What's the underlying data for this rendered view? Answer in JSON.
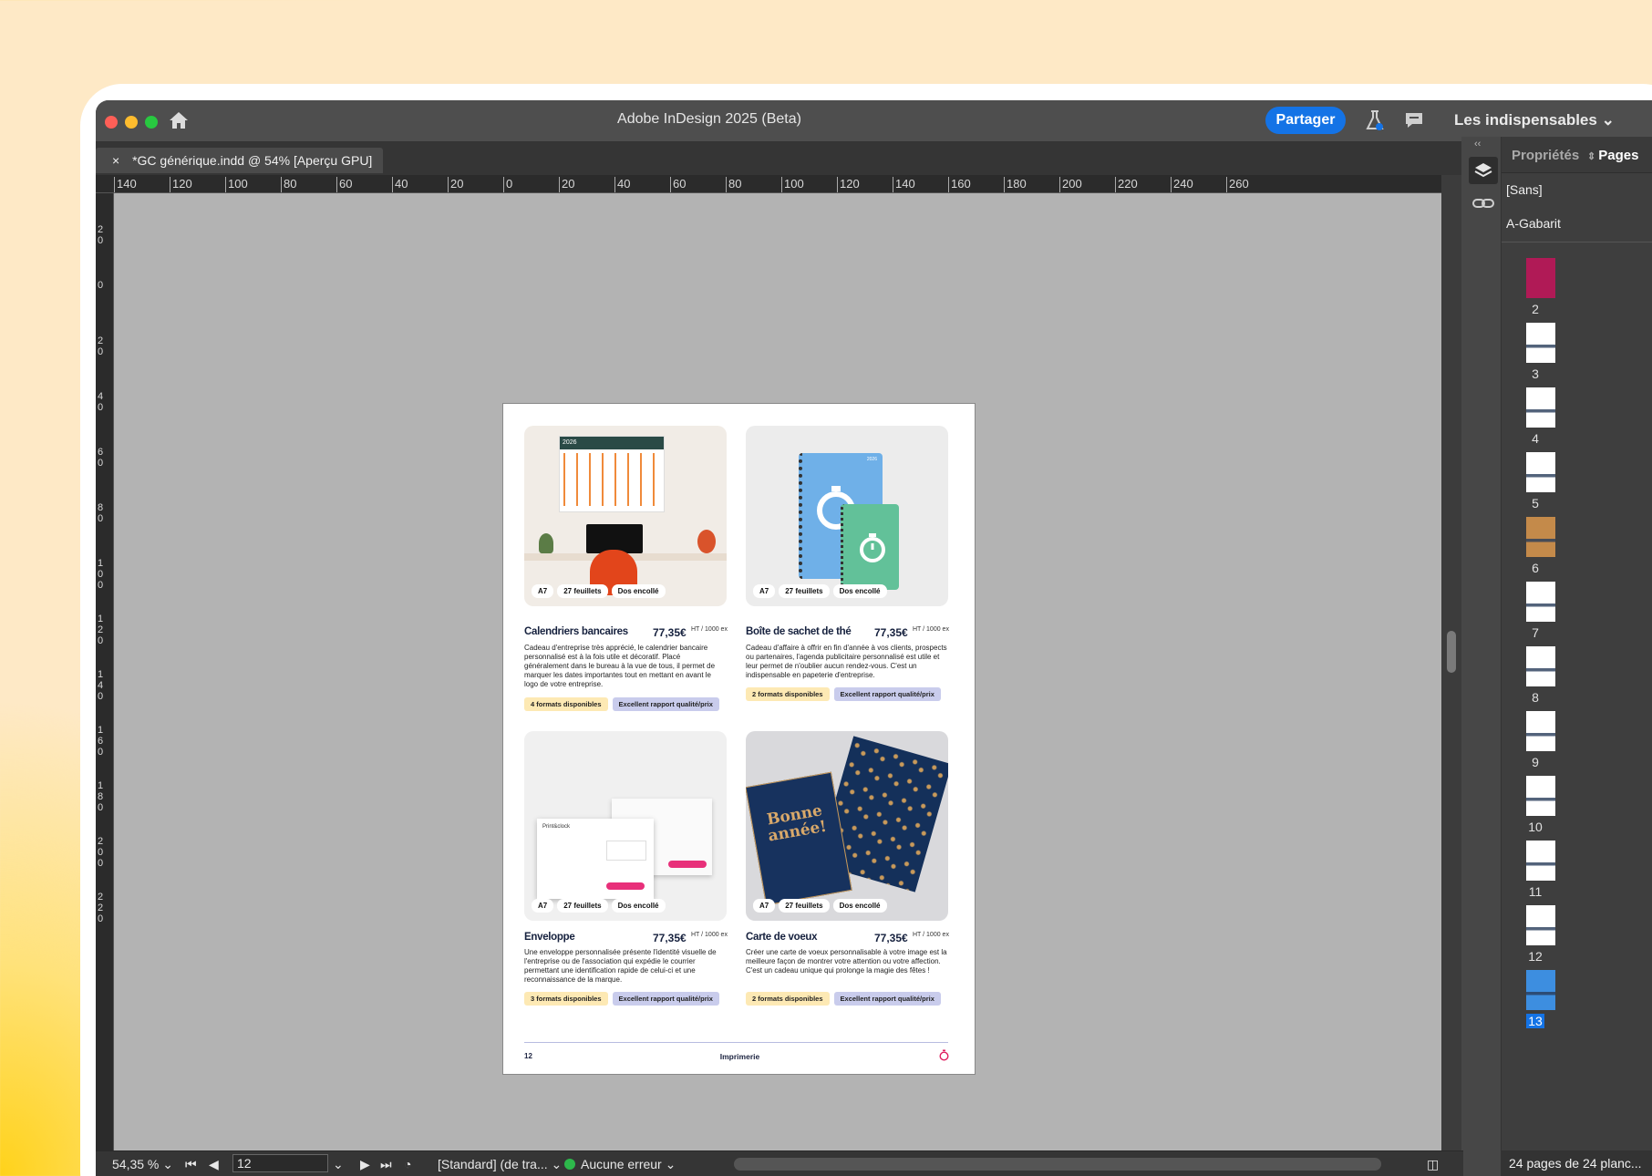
{
  "window": {
    "title": "Adobe InDesign 2025 (Beta)",
    "share_label": "Partager",
    "workspace": "Les indispensables"
  },
  "document_tab": {
    "close": "×",
    "label": "*GC générique.indd @ 54% [Aperçu GPU]"
  },
  "ruler_h": [
    "140",
    "120",
    "100",
    "80",
    "60",
    "40",
    "20",
    "0",
    "20",
    "40",
    "60",
    "80",
    "100",
    "120",
    "140",
    "160",
    "180",
    "200",
    "220",
    "240",
    "260"
  ],
  "ruler_v": [
    "2 0",
    "0",
    "2 0",
    "4 0",
    "6 0",
    "8 0",
    "1 0 0",
    "1 2 0",
    "1 4 0",
    "1 6 0",
    "1 8 0",
    "2 0 0",
    "2 2 0"
  ],
  "panel": {
    "tab_properties": "Propriétés",
    "tab_pages": "Pages",
    "none_master": "[Sans]",
    "a_master": "A-Gabarit",
    "footer": "24 pages de 24 planc...",
    "pages": [
      "2",
      "3",
      "4",
      "5",
      "6",
      "7",
      "8",
      "9",
      "10",
      "11",
      "12",
      "13"
    ],
    "selected_page": "13"
  },
  "status": {
    "zoom": "54,35 %",
    "page": "12",
    "style": "[Standard] (de tra...",
    "errors": "Aucune erreur"
  },
  "doc_page": {
    "products": [
      {
        "title": "Calendriers bancaires",
        "price": "77,35€",
        "unit": "HT / 1000 ex",
        "desc": "Cadeau d'entreprise très apprécié, le calendrier bancaire personnalisé est à la fois utile et décoratif. Placé généralement dans le bureau à la vue de tous, il permet de marquer les dates importantes tout en mettant en avant le logo de votre entreprise.",
        "chip1": "4 formats disponibles",
        "chip2": "Excellent rapport qualité/prix",
        "badges": [
          "A7",
          "27 feuillets",
          "Dos encollé"
        ]
      },
      {
        "title": "Boîte de sachet de thé",
        "price": "77,35€",
        "unit": "HT / 1000 ex",
        "desc": "Cadeau d'affaire à offrir en fin d'année à vos clients, prospects ou partenaires, l'agenda publicitaire personnalisé est utile et leur permet de n'oublier aucun rendez-vous. C'est un indispensable en papeterie d'entreprise.",
        "chip1": "2 formats disponibles",
        "chip2": "Excellent rapport qualité/prix",
        "badges": [
          "A7",
          "27 feuillets",
          "Dos encollé"
        ]
      },
      {
        "title": "Enveloppe",
        "price": "77,35€",
        "unit": "HT / 1000 ex",
        "desc": "Une enveloppe personnalisée présente l'identité visuelle de l'entreprise ou de l'association qui expédie le courrier permettant une identification rapide de celui-ci et une reconnaissance de la marque.",
        "chip1": "3 formats disponibles",
        "chip2": "Excellent rapport qualité/prix",
        "badges": [
          "A7",
          "27 feuillets",
          "Dos encollé"
        ]
      },
      {
        "title": "Carte de voeux",
        "price": "77,35€",
        "unit": "HT / 1000 ex",
        "desc": "Créer une carte de voeux personnalisable à votre image est la meilleure façon de montrer votre attention ou votre affection. C'est un cadeau unique qui prolonge la magie des fêtes !",
        "chip1": "2 formats disponibles",
        "chip2": "Excellent rapport qualité/prix",
        "badges": [
          "A7",
          "27 feuillets",
          "Dos encollé"
        ]
      }
    ],
    "footer_page": "12",
    "footer_section": "Imprimerie",
    "calendar_year": "2026",
    "notebook_year": "2026",
    "envelope_brand": "Print&clock",
    "card_text": "Bonne année!"
  }
}
